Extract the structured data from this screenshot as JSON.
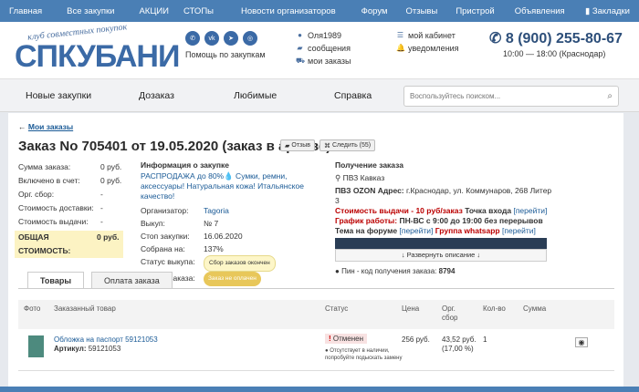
{
  "topnav": [
    "Главная",
    "Все закупки",
    "АКЦИИ",
    "СТОПы",
    "Новости организаторов",
    "Форум",
    "Отзывы",
    "Пристрой",
    "Объявления",
    "Закладки"
  ],
  "logo": {
    "tagline": "клуб совместных покупок",
    "name": "СПКУБАНИ"
  },
  "help_text": "Помощь по закупкам",
  "user": {
    "name": "Оля1989",
    "messages": "сообщения",
    "orders": "мои заказы",
    "cabinet": "мой кабинет",
    "notifications": "уведомления"
  },
  "contact": {
    "phone": "8 (900) 255-80-67",
    "hours": "10:00 — 18:00 (Краснодар)"
  },
  "mainmenu": [
    "Новые закупки",
    "Дозаказ",
    "Любимые",
    "Справка"
  ],
  "search": {
    "placeholder": "Воспользуйтесь поиском..."
  },
  "back_link": "Мои заказы",
  "order": {
    "title": "Заказ No 705401 от 19.05.2020 (заказ в архиве)",
    "review_btn": "Отзыв",
    "follow_btn": "Следить (55)"
  },
  "sums": [
    {
      "k": "Сумма заказа:",
      "v": "0 руб."
    },
    {
      "k": "Включено в счет:",
      "v": "0 руб."
    },
    {
      "k": "Орг. сбор:",
      "v": "-"
    },
    {
      "k": "Стоимость доставки:",
      "v": "-"
    },
    {
      "k": "Стоимость выдачи:",
      "v": "-"
    }
  ],
  "total": {
    "k": "ОБЩАЯ СТОИМОСТЬ:",
    "v": "0 руб."
  },
  "purchase": {
    "heading": "Информация о закупке",
    "link": "РАСПРОДАЖА до 80%💧 Сумки, ремни, аксессуары! Натуральная кожа! Итальянское качество!",
    "rows": [
      {
        "k": "Организатор:",
        "v": "Tagoria"
      },
      {
        "k": "Выкуп:",
        "v": "№ 7"
      },
      {
        "k": "Стоп закупки:",
        "v": "16.06.2020"
      },
      {
        "k": "Собрана на:",
        "v": "137%"
      }
    ],
    "status_k": "Статус выкупа:",
    "status_v": "Сбор заказов окончен",
    "pay_k": "Оплата заказа:",
    "pay_v": "Заказ не оплачен"
  },
  "pickup": {
    "heading": "Получение заказа",
    "place": "ПВЗ Кавказ",
    "addr_label": "ПВЗ OZON Адрес:",
    "addr": "г.Краснодар, ул. Коммунаров, 268 Литер 3",
    "cost": "Стоимость выдачи - 10 руб/заказ",
    "point": "Точка входа",
    "sched": "График работы:",
    "sched_val": "ПН-ВС с 9:00 до 19:00 без перерывов",
    "forum": "Тема на форуме",
    "wa": "Группа whatsapp",
    "go": "[перейти]",
    "expand": "↓ Развернуть описание ↓",
    "pin_label": "Пин - код получения заказа:",
    "pin": "8794"
  },
  "tabs": [
    "Товары",
    "Оплата заказа"
  ],
  "table": {
    "headers": [
      "Фото",
      "Заказанный товар",
      "Статус",
      "Цена",
      "Орг. сбор",
      "Кол-во",
      "Сумма"
    ],
    "rows": [
      {
        "name": "Обложка на паспорт 59121053",
        "article_label": "Артикул:",
        "article": "59121053",
        "status": "Отменен",
        "note": "Отсутствует в наличии, попробуйте подыскать замену",
        "price": "256 руб.",
        "fee": "43,52 руб. (17,00 %)",
        "qty": "1",
        "sum": ""
      }
    ]
  }
}
